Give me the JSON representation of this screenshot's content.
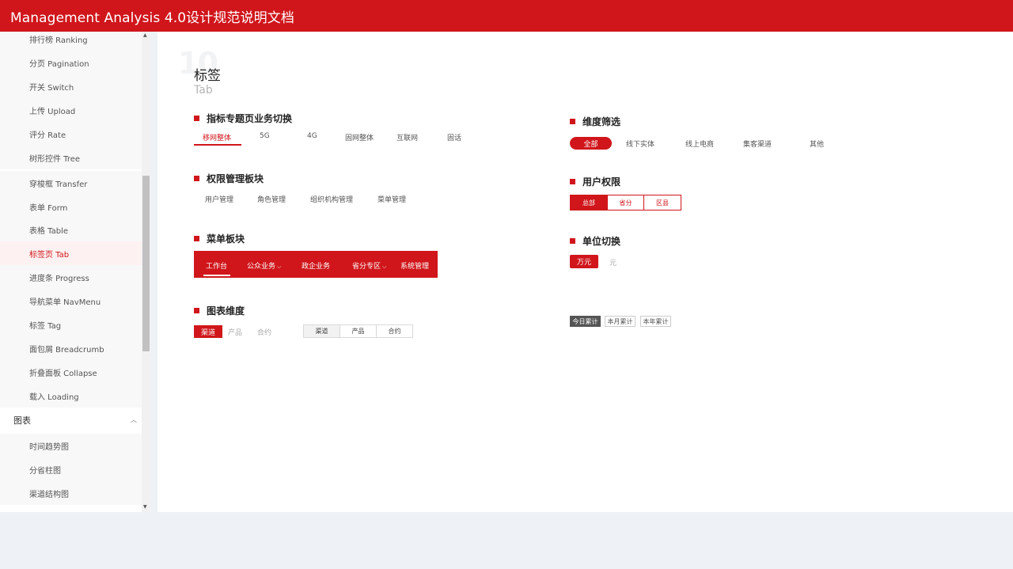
{
  "header": {
    "title": "Management Analysis 4.0设计规范说明文档"
  },
  "sidebar": {
    "items": [
      {
        "label": "排行榜  Ranking"
      },
      {
        "label": "分页 Pagination"
      },
      {
        "label": "开关 Switch"
      },
      {
        "label": "上传 Upload"
      },
      {
        "label": "评分 Rate"
      },
      {
        "label": "树形控件 Tree"
      },
      {
        "label": "穿梭框 Transfer"
      },
      {
        "label": "表单 Form"
      },
      {
        "label": "表格 Table"
      },
      {
        "label": "标签页 Tab"
      },
      {
        "label": "进度条 Progress"
      },
      {
        "label": "导航菜单 NavMenu"
      },
      {
        "label": "标签 Tag"
      },
      {
        "label": "面包屑 Breadcrumb"
      },
      {
        "label": "折叠面板 Collapse"
      },
      {
        "label": "载入 Loading"
      }
    ],
    "active_index": 9,
    "group": {
      "label": "图表",
      "expanded": true
    },
    "sub_items": [
      {
        "label": "时间趋势图"
      },
      {
        "label": "分省柱图"
      },
      {
        "label": "渠道结构图"
      }
    ]
  },
  "main": {
    "number": "10",
    "title": "标签",
    "subtitle": "Tab",
    "sections": {
      "indicator": {
        "title": "指标专题页业务切换",
        "tabs": [
          "移网整体",
          "5G",
          "4G",
          "固网整体",
          "互联网",
          "固话"
        ],
        "active": 0
      },
      "permission_block": {
        "title": "权限管理板块",
        "tabs": [
          "用户管理",
          "角色管理",
          "组织机构管理",
          "菜单管理"
        ]
      },
      "menu_block": {
        "title": "菜单板块",
        "items": [
          "工作台",
          "公众业务",
          "政企业务",
          "省分专区",
          "系统管理"
        ],
        "active": 0
      },
      "chart_dimension": {
        "title": "图表维度",
        "tabs": [
          "渠道",
          "产品",
          "合约"
        ],
        "boxed_tabs": [
          "渠道",
          "产品",
          "合约"
        ]
      },
      "dimension_filter": {
        "title": "维度筛选",
        "options": [
          "全部",
          "线下实体",
          "线上电商",
          "集客渠道",
          "其他"
        ],
        "active": 0
      },
      "user_permission": {
        "title": "用户权限",
        "options": [
          "总部",
          "省分",
          "区县"
        ],
        "active": 0
      },
      "unit_switch": {
        "title": "单位切换",
        "options": [
          "万元",
          "元"
        ],
        "active": 0
      },
      "period": {
        "options": [
          "今日累计",
          "本月累计",
          "本年累计"
        ],
        "active": 0
      }
    }
  },
  "colors": {
    "brand_red": "#d0161b",
    "dark_gray": "#555555"
  }
}
